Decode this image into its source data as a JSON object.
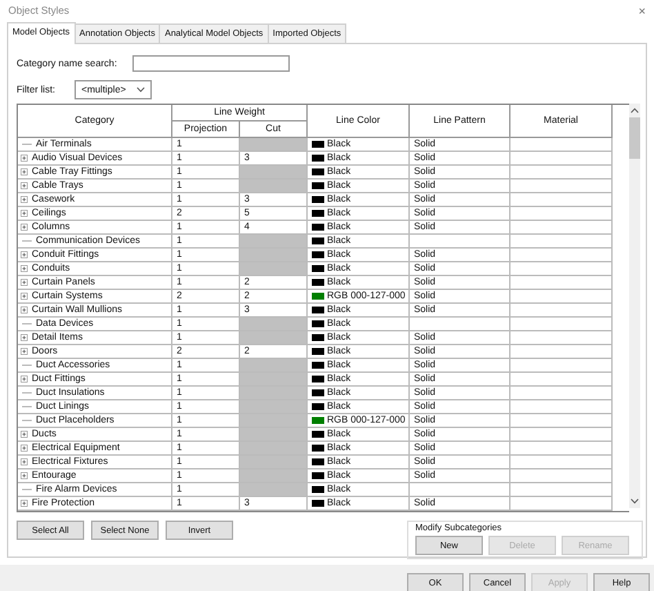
{
  "window": {
    "title": "Object Styles",
    "close": "×"
  },
  "tabs": [
    {
      "label": "Model Objects",
      "selected": true
    },
    {
      "label": "Annotation Objects",
      "selected": false
    },
    {
      "label": "Analytical Model Objects",
      "selected": false
    },
    {
      "label": "Imported Objects",
      "selected": false
    }
  ],
  "search": {
    "label": "Category name search:"
  },
  "filter": {
    "label": "Filter list:",
    "value": "<multiple>"
  },
  "table": {
    "columns": {
      "category": "Category",
      "line_weight": "Line Weight",
      "projection": "Projection",
      "cut": "Cut",
      "line_color": "Line Color",
      "line_pattern": "Line Pattern",
      "material": "Material"
    },
    "rows": [
      {
        "category": "Air Terminals",
        "expandable": false,
        "projection": "1",
        "line_color": "Black",
        "color": "#000000",
        "line_pattern": "Solid"
      },
      {
        "category": "Audio Visual Devices",
        "expandable": true,
        "projection": "1",
        "cut": "3",
        "line_color": "Black",
        "color": "#000000",
        "line_pattern": "Solid"
      },
      {
        "category": "Cable Tray Fittings",
        "expandable": true,
        "projection": "1",
        "line_color": "Black",
        "color": "#000000",
        "line_pattern": "Solid"
      },
      {
        "category": "Cable Trays",
        "expandable": true,
        "projection": "1",
        "line_color": "Black",
        "color": "#000000",
        "line_pattern": "Solid"
      },
      {
        "category": "Casework",
        "expandable": true,
        "projection": "1",
        "cut": "3",
        "line_color": "Black",
        "color": "#000000",
        "line_pattern": "Solid"
      },
      {
        "category": "Ceilings",
        "expandable": true,
        "projection": "2",
        "cut": "5",
        "line_color": "Black",
        "color": "#000000",
        "line_pattern": "Solid"
      },
      {
        "category": "Columns",
        "expandable": true,
        "projection": "1",
        "cut": "4",
        "line_color": "Black",
        "color": "#000000",
        "line_pattern": "Solid"
      },
      {
        "category": "Communication Devices",
        "expandable": false,
        "projection": "1",
        "line_color": "Black",
        "color": "#000000"
      },
      {
        "category": "Conduit Fittings",
        "expandable": true,
        "projection": "1",
        "line_color": "Black",
        "color": "#000000",
        "line_pattern": "Solid"
      },
      {
        "category": "Conduits",
        "expandable": true,
        "projection": "1",
        "line_color": "Black",
        "color": "#000000",
        "line_pattern": "Solid"
      },
      {
        "category": "Curtain Panels",
        "expandable": true,
        "projection": "1",
        "cut": "2",
        "line_color": "Black",
        "color": "#000000",
        "line_pattern": "Solid"
      },
      {
        "category": "Curtain Systems",
        "expandable": true,
        "projection": "2",
        "cut": "2",
        "line_color": "RGB 000-127-000",
        "color": "#007f00",
        "line_pattern": "Solid"
      },
      {
        "category": "Curtain Wall Mullions",
        "expandable": true,
        "projection": "1",
        "cut": "3",
        "line_color": "Black",
        "color": "#000000",
        "line_pattern": "Solid"
      },
      {
        "category": "Data Devices",
        "expandable": false,
        "projection": "1",
        "line_color": "Black",
        "color": "#000000"
      },
      {
        "category": "Detail Items",
        "expandable": true,
        "projection": "1",
        "line_color": "Black",
        "color": "#000000",
        "line_pattern": "Solid"
      },
      {
        "category": "Doors",
        "expandable": true,
        "projection": "2",
        "cut": "2",
        "line_color": "Black",
        "color": "#000000",
        "line_pattern": "Solid"
      },
      {
        "category": "Duct Accessories",
        "expandable": false,
        "projection": "1",
        "line_color": "Black",
        "color": "#000000",
        "line_pattern": "Solid"
      },
      {
        "category": "Duct Fittings",
        "expandable": true,
        "projection": "1",
        "line_color": "Black",
        "color": "#000000",
        "line_pattern": "Solid"
      },
      {
        "category": "Duct Insulations",
        "expandable": false,
        "projection": "1",
        "line_color": "Black",
        "color": "#000000",
        "line_pattern": "Solid"
      },
      {
        "category": "Duct Linings",
        "expandable": false,
        "projection": "1",
        "line_color": "Black",
        "color": "#000000",
        "line_pattern": "Solid"
      },
      {
        "category": "Duct Placeholders",
        "expandable": false,
        "projection": "1",
        "line_color": "RGB 000-127-000",
        "color": "#007f00",
        "line_pattern": "Solid"
      },
      {
        "category": "Ducts",
        "expandable": true,
        "projection": "1",
        "line_color": "Black",
        "color": "#000000",
        "line_pattern": "Solid"
      },
      {
        "category": "Electrical Equipment",
        "expandable": true,
        "projection": "1",
        "line_color": "Black",
        "color": "#000000",
        "line_pattern": "Solid"
      },
      {
        "category": "Electrical Fixtures",
        "expandable": true,
        "projection": "1",
        "line_color": "Black",
        "color": "#000000",
        "line_pattern": "Solid"
      },
      {
        "category": "Entourage",
        "expandable": true,
        "projection": "1",
        "line_color": "Black",
        "color": "#000000",
        "line_pattern": "Solid"
      },
      {
        "category": "Fire Alarm Devices",
        "expandable": false,
        "projection": "1",
        "line_color": "Black",
        "color": "#000000"
      },
      {
        "category": "Fire Protection",
        "expandable": true,
        "projection": "1",
        "cut": "3",
        "line_color": "Black",
        "color": "#000000",
        "line_pattern": "Solid"
      }
    ]
  },
  "selection_buttons": [
    {
      "label": "Select All"
    },
    {
      "label": "Select None"
    },
    {
      "label": "Invert"
    }
  ],
  "modify_subcategories": {
    "title": "Modify Subcategories",
    "buttons": [
      {
        "label": "New",
        "disabled": false
      },
      {
        "label": "Delete",
        "disabled": true
      },
      {
        "label": "Rename",
        "disabled": true
      }
    ]
  },
  "dialog_buttons": [
    {
      "label": "OK",
      "disabled": false
    },
    {
      "label": "Cancel",
      "disabled": false
    },
    {
      "label": "Apply",
      "disabled": true
    },
    {
      "label": "Help",
      "disabled": false
    }
  ]
}
